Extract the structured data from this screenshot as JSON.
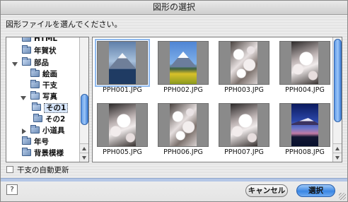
{
  "window": {
    "title": "図形の選択"
  },
  "prompt": "図形ファイルを選んでください。",
  "tree": {
    "items": [
      {
        "label": "HTML",
        "disclosure": "none",
        "selected": false
      },
      {
        "label": "年賀状",
        "disclosure": "none",
        "selected": false
      },
      {
        "label": "部品",
        "disclosure": "open",
        "selected": false
      },
      {
        "label": "絵画",
        "disclosure": "none",
        "selected": false
      },
      {
        "label": "干支",
        "disclosure": "none",
        "selected": false
      },
      {
        "label": "写真",
        "disclosure": "open",
        "selected": false
      },
      {
        "label": "その1",
        "disclosure": "none",
        "selected": true
      },
      {
        "label": "その2",
        "disclosure": "none",
        "selected": false
      },
      {
        "label": "小道具",
        "disclosure": "closed",
        "selected": false
      },
      {
        "label": "年号",
        "disclosure": "none",
        "selected": false
      },
      {
        "label": "背景模様",
        "disclosure": "none",
        "selected": false
      }
    ]
  },
  "thumbnails": [
    {
      "filename": "PPH001.JPG",
      "image": "fuji-lake",
      "selected": true
    },
    {
      "filename": "PPH002.JPG",
      "image": "fuji-flowers",
      "selected": false
    },
    {
      "filename": "PPH003.JPG",
      "image": "cherry-blossoms",
      "selected": false
    },
    {
      "filename": "PPH004.JPG",
      "image": "cherry-blossoms",
      "selected": false
    },
    {
      "filename": "PPH005.JPG",
      "image": "cherry-blossoms",
      "selected": false
    },
    {
      "filename": "PPH006.JPG",
      "image": "cherry-blossoms",
      "selected": false
    },
    {
      "filename": "PPH007.JPG",
      "image": "cherry-blossoms",
      "selected": false
    },
    {
      "filename": "PPH008.JPG",
      "image": "fuji-night",
      "selected": false
    }
  ],
  "auto_update": {
    "label": "干支の自動更新",
    "checked": false
  },
  "buttons": {
    "help": "?",
    "cancel": "キャンセル",
    "ok": "選択"
  },
  "colors": {
    "accent": "#3a86e4",
    "selection_outline": "#8eb9ef",
    "bottom_bar": "#b5c7e6"
  }
}
